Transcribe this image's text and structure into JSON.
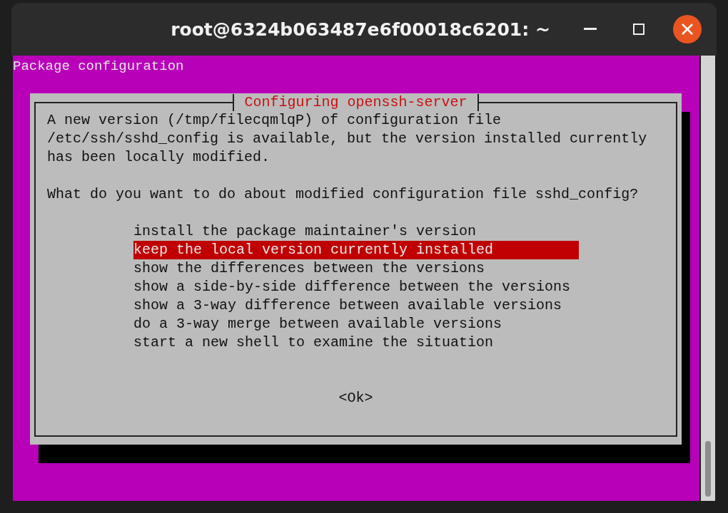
{
  "window": {
    "title": "root@6324b063487e6f00018c6201: ~"
  },
  "terminal": {
    "header": "Package configuration"
  },
  "dialog": {
    "title": "Configuring openssh-server",
    "message_lines": [
      "A new version (/tmp/filecqmlqP) of configuration file",
      "/etc/ssh/sshd_config is available, but the version installed currently",
      "has been locally modified."
    ],
    "question": "What do you want to do about modified configuration file sshd_config?",
    "options": [
      {
        "label": "install the package maintainer's version",
        "selected": false
      },
      {
        "label": "keep the local version currently installed",
        "selected": true
      },
      {
        "label": "show the differences between the versions",
        "selected": false
      },
      {
        "label": "show a side-by-side difference between the versions",
        "selected": false
      },
      {
        "label": "show a 3-way difference between available versions",
        "selected": false
      },
      {
        "label": "do a 3-way merge between available versions",
        "selected": false
      },
      {
        "label": "start a new shell to examine the situation",
        "selected": false
      }
    ],
    "button": "<Ok>"
  }
}
